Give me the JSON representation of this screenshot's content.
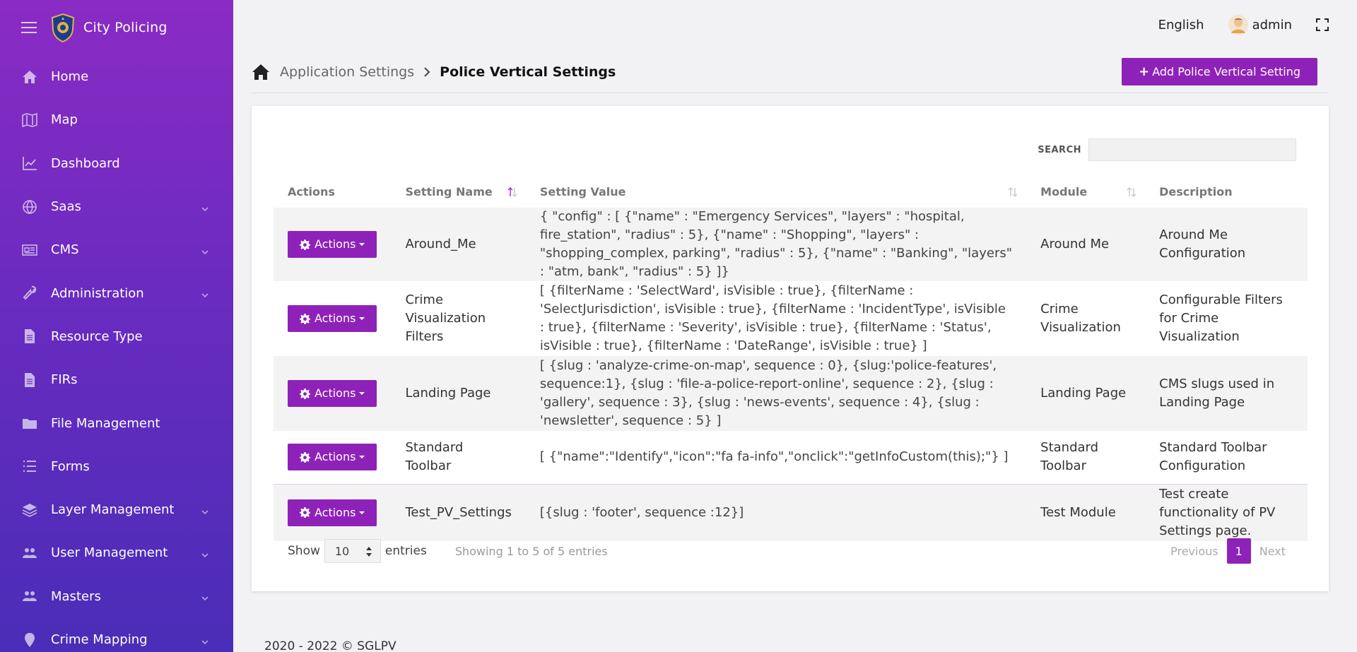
{
  "brand": {
    "name": "City Policing"
  },
  "sidebar": {
    "items": [
      {
        "label": "Home",
        "icon": "home-icon",
        "expandable": false
      },
      {
        "label": "Map",
        "icon": "map-icon",
        "expandable": false
      },
      {
        "label": "Dashboard",
        "icon": "chart-icon",
        "expandable": false
      },
      {
        "label": "Saas",
        "icon": "globe-icon",
        "expandable": true
      },
      {
        "label": "CMS",
        "icon": "newspaper-icon",
        "expandable": true
      },
      {
        "label": "Administration",
        "icon": "wrench-icon",
        "expandable": true
      },
      {
        "label": "Resource Type",
        "icon": "file-icon",
        "expandable": false
      },
      {
        "label": "FIRs",
        "icon": "file-icon",
        "expandable": false
      },
      {
        "label": "File Management",
        "icon": "folder-icon",
        "expandable": false
      },
      {
        "label": "Forms",
        "icon": "list-icon",
        "expandable": false
      },
      {
        "label": "Layer Management",
        "icon": "layers-icon",
        "expandable": true
      },
      {
        "label": "User Management",
        "icon": "users-icon",
        "expandable": true
      },
      {
        "label": "Masters",
        "icon": "users-icon",
        "expandable": true
      },
      {
        "label": "Crime Mapping",
        "icon": "pin-icon",
        "expandable": true
      }
    ]
  },
  "topbar": {
    "language": "English",
    "user": "admin"
  },
  "breadcrumb": {
    "parent": "Application Settings",
    "current": "Police Vertical Settings"
  },
  "add_button": {
    "plus": "+",
    "label": "Add Police Vertical Setting"
  },
  "search": {
    "label": "SEARCH",
    "value": ""
  },
  "table": {
    "columns": [
      "Actions",
      "Setting Name",
      "Setting Value",
      "Module",
      "Description"
    ],
    "action_label": "Actions",
    "rows": [
      {
        "name": "Around_Me",
        "value": "{ \"config\" : [ {\"name\" : \"Emergency Services\", \"layers\" : \"hospital, fire_station\", \"radius\" : 5}, {\"name\" : \"Shopping\", \"layers\" : \"shopping_complex, parking\", \"radius\" : 5}, {\"name\" : \"Banking\", \"layers\" : \"atm, bank\", \"radius\" : 5} ]}",
        "module": "Around Me",
        "description": "Around Me Configuration"
      },
      {
        "name": "Crime Visualization Filters",
        "value": "[ {filterName : 'SelectWard', isVisible : true}, {filterName : 'SelectJurisdiction', isVisible : true}, {filterName : 'IncidentType', isVisible : true}, {filterName : 'Severity', isVisible : true}, {filterName : 'Status', isVisible : true}, {filterName : 'DateRange', isVisible : true} ]",
        "module": "Crime Visualization",
        "description": "Configurable Filters for Crime Visualization"
      },
      {
        "name": "Landing Page",
        "value": "[ {slug : 'analyze-crime-on-map', sequence : 0}, {slug:'police-features', sequence:1}, {slug : 'file-a-police-report-online', sequence : 2}, {slug : 'gallery', sequence : 3}, {slug : 'news-events', sequence : 4}, {slug : 'newsletter', sequence : 5} ]",
        "module": "Landing Page",
        "description": "CMS slugs used in Landing Page"
      },
      {
        "name": "Standard Toolbar",
        "value": "[ {\"name\":\"Identify\",\"icon\":\"fa fa-info\",\"onclick\":\"getInfoCustom(this);\"} ]",
        "module": "Standard Toolbar",
        "description": "Standard Toolbar Configuration"
      },
      {
        "name": "Test_PV_Settings",
        "value": "[{slug : 'footer', sequence :12}]",
        "module": "Test Module",
        "description": "Test create functionality of PV Settings page."
      }
    ]
  },
  "length": {
    "show": "Show",
    "value": "10",
    "entries": "entries"
  },
  "info": "Showing 1 to 5 of 5 entries",
  "pagination": {
    "previous": "Previous",
    "current": "1",
    "next": "Next"
  },
  "footer": {
    "copyright": "2020 - 2022 © SGLPV"
  },
  "colors": {
    "accent": "#8e22b8",
    "sidebar_top": "#8a2bc4",
    "sidebar_bottom": "#4a2db8"
  }
}
